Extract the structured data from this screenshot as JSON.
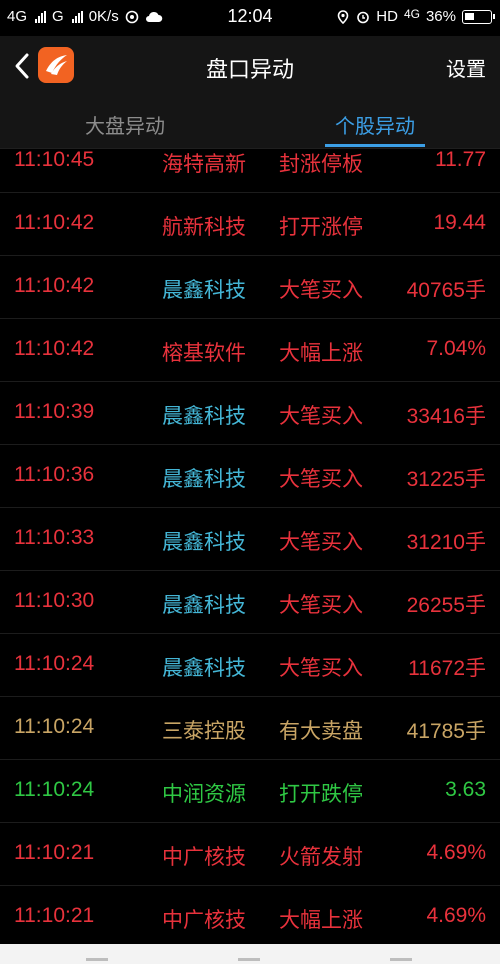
{
  "status_bar": {
    "network1": "4G",
    "network2": "G",
    "speed": "0K/s",
    "time": "12:04",
    "hd": "HD",
    "network3": "4G",
    "battery": "36%"
  },
  "header": {
    "title": "盘口异动",
    "settings_label": "设置"
  },
  "tabs": [
    {
      "label": "大盘异动",
      "active": false
    },
    {
      "label": "个股异动",
      "active": true
    }
  ],
  "colors": {
    "red": "#e8323c",
    "cyan": "#44b6d6",
    "gold": "#c9a565",
    "green": "#2fc844",
    "accent": "#3c9fe6"
  },
  "rows": [
    {
      "time": "11:10:45",
      "name": "海特高新",
      "event": "封涨停板",
      "value": "11.77",
      "name_color": "red",
      "row_color": "red"
    },
    {
      "time": "11:10:42",
      "name": "航新科技",
      "event": "打开涨停",
      "value": "19.44",
      "name_color": "red",
      "row_color": "red"
    },
    {
      "time": "11:10:42",
      "name": "晨鑫科技",
      "event": "大笔买入",
      "value": "40765手",
      "name_color": "cyan",
      "row_color": "red"
    },
    {
      "time": "11:10:42",
      "name": "榕基软件",
      "event": "大幅上涨",
      "value": "7.04%",
      "name_color": "red",
      "row_color": "red"
    },
    {
      "time": "11:10:39",
      "name": "晨鑫科技",
      "event": "大笔买入",
      "value": "33416手",
      "name_color": "cyan",
      "row_color": "red"
    },
    {
      "time": "11:10:36",
      "name": "晨鑫科技",
      "event": "大笔买入",
      "value": "31225手",
      "name_color": "cyan",
      "row_color": "red"
    },
    {
      "time": "11:10:33",
      "name": "晨鑫科技",
      "event": "大笔买入",
      "value": "31210手",
      "name_color": "cyan",
      "row_color": "red"
    },
    {
      "time": "11:10:30",
      "name": "晨鑫科技",
      "event": "大笔买入",
      "value": "26255手",
      "name_color": "cyan",
      "row_color": "red"
    },
    {
      "time": "11:10:24",
      "name": "晨鑫科技",
      "event": "大笔买入",
      "value": "11672手",
      "name_color": "cyan",
      "row_color": "red"
    },
    {
      "time": "11:10:24",
      "name": "三泰控股",
      "event": "有大卖盘",
      "value": "41785手",
      "name_color": "gold",
      "row_color": "gold"
    },
    {
      "time": "11:10:24",
      "name": "中润资源",
      "event": "打开跌停",
      "value": "3.63",
      "name_color": "green",
      "row_color": "green"
    },
    {
      "time": "11:10:21",
      "name": "中广核技",
      "event": "火箭发射",
      "value": "4.69%",
      "name_color": "red",
      "row_color": "red"
    },
    {
      "time": "11:10:21",
      "name": "中广核技",
      "event": "大幅上涨",
      "value": "4.69%",
      "name_color": "red",
      "row_color": "red"
    }
  ]
}
